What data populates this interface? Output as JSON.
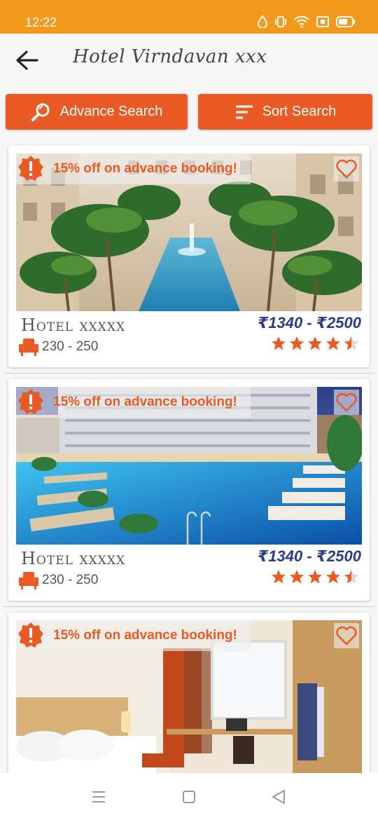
{
  "status_bar": {
    "time": "12:22"
  },
  "app": {
    "title": "Hotel Virndavan xxx"
  },
  "buttons": {
    "advance_search": "Advance Search",
    "sort_search": "Sort Search"
  },
  "hotels": [
    {
      "offer": "15% off on advance booking!",
      "name": "Hotel xxxxx",
      "price": "₹1340 - ₹2500",
      "seats": "230 - 250",
      "rating": 4.5,
      "image": "resort courtyard pool with palm trees"
    },
    {
      "offer": "15% off on advance booking!",
      "name": "Hotel xxxxx",
      "price": "₹1340 - ₹2500",
      "seats": "230 - 250",
      "rating": 4.5,
      "image": "hotel pool at night with loungers"
    },
    {
      "offer": "15% off on advance booking!",
      "name": "",
      "price": "",
      "seats": "",
      "rating": null,
      "image": "hotel bedroom with window"
    }
  ],
  "colors": {
    "status_bar": "#f39a1c",
    "accent": "#e95a25",
    "price": "#2e3a8c"
  }
}
